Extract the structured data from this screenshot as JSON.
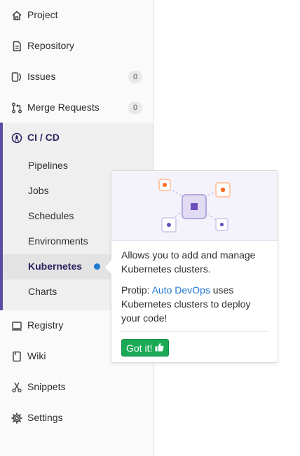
{
  "sidebar": {
    "items": [
      {
        "label": "Project",
        "icon": "home-icon"
      },
      {
        "label": "Repository",
        "icon": "doc-icon"
      },
      {
        "label": "Issues",
        "icon": "issues-icon",
        "badge": "0"
      },
      {
        "label": "Merge Requests",
        "icon": "merge-request-icon",
        "badge": "0"
      }
    ],
    "cicd": {
      "label": "CI / CD",
      "icon": "rocket-icon",
      "subitems": [
        {
          "label": "Pipelines"
        },
        {
          "label": "Jobs"
        },
        {
          "label": "Schedules"
        },
        {
          "label": "Environments"
        },
        {
          "label": "Kubernetes",
          "active": true
        },
        {
          "label": "Charts"
        }
      ]
    },
    "bottom_items": [
      {
        "label": "Registry",
        "icon": "container-icon"
      },
      {
        "label": "Wiki",
        "icon": "book-icon"
      },
      {
        "label": "Snippets",
        "icon": "scissors-icon"
      },
      {
        "label": "Settings",
        "icon": "gear-icon"
      }
    ]
  },
  "popover": {
    "text1": "Allows you to add and manage Kubernetes clusters.",
    "protip_prefix": "Protip: ",
    "protip_link": "Auto DevOps",
    "protip_suffix": " uses Kubernetes clusters to deploy your code!",
    "button_label": "Got it!",
    "button_icon": "thumbs-up-icon"
  },
  "colors": {
    "accent": "#5b4ba3",
    "link": "#1f78d1",
    "success": "#1aaa55",
    "orange": "#fc6d26"
  }
}
